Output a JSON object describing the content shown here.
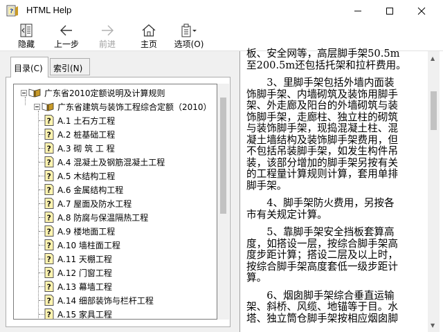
{
  "window": {
    "title": "HTML Help"
  },
  "toolbar": {
    "hide_label": "隐藏",
    "back_label": "上一步",
    "forward_label": "前进",
    "home_label": "主页",
    "options_label": "选项(O)"
  },
  "tabs": {
    "contents_label": "目录(C)",
    "index_label": "索引(N)"
  },
  "tree": {
    "root": "广东省2010定额说明及计算规则",
    "book": "广东省建筑与装饰工程综合定额（2010）",
    "items": [
      "A.1  土石方工程",
      "A.2  桩基础工程",
      "A.3  砌  筑  工  程",
      "A.4  混凝土及钢筋混凝土工程",
      "A.5  木结构工程",
      "A.6  金属结构工程",
      "A.7  屋面及防水工程",
      "A.8  防腐与保温隔热工程",
      "A.9  楼地面工程",
      "A.10  墙柱面工程",
      "A.11  天棚工程",
      "A.12  门窗工程",
      "A.13  幕墙工程",
      "A.14  细部装饰与栏杆工程",
      "A.15  家具工程"
    ]
  },
  "content": {
    "lines": [
      "板、安全网等，高层脚手架50.5m",
      "至200.5m还包括托架和拉杆费用。",
      "　　3、里脚手架包括外墙内面装",
      "饰脚手架、内墙砌筑及装饰用脚手",
      "架、外走廊及阳台的外墙砌筑与装",
      "饰脚手架，走廊柱、独立柱的砌筑",
      "与装饰脚手架，现捣混凝土柱、混",
      "凝土墙结构及装饰脚手架费用，但",
      "不包括吊装脚手架，如发生构件吊",
      "装，该部分增加的脚手架另按有关",
      "的工程量计算规则计算，套用单排",
      "脚手架。",
      "　　4、脚手架防火费用，另按各",
      "市有关规定计算。",
      "　　5、靠脚手架安全挡板套算高",
      "度，如搭设一层，按综合脚手架高",
      "度步距计算；搭设二层及以上时，",
      "按综合脚手架高度套低一级步距计",
      "算。",
      "　　6、烟囱脚手架综合垂直运输",
      "架、斜桥、风缆、地锚等于目。水",
      "塔、独立筒仓脚手架按相应烟囱脚"
    ]
  },
  "colors": {
    "book_icon": "#c89a28",
    "help_icon_bg": "#fff4b0",
    "chrome_bg": "#f0f0f0"
  }
}
